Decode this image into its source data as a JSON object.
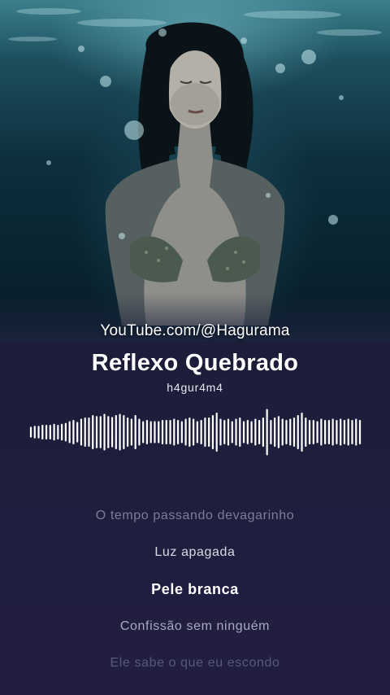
{
  "watermark": "YouTube.com/@Hagurama",
  "track": {
    "title": "Reflexo Quebrado",
    "artist": "h4gur4m4"
  },
  "waveform_levels": [
    0.22,
    0.26,
    0.26,
    0.3,
    0.3,
    0.3,
    0.34,
    0.3,
    0.34,
    0.38,
    0.45,
    0.5,
    0.42,
    0.55,
    0.6,
    0.6,
    0.7,
    0.66,
    0.66,
    0.75,
    0.66,
    0.62,
    0.7,
    0.75,
    0.7,
    0.6,
    0.55,
    0.7,
    0.55,
    0.45,
    0.5,
    0.45,
    0.45,
    0.45,
    0.5,
    0.5,
    0.5,
    0.55,
    0.5,
    0.45,
    0.55,
    0.6,
    0.55,
    0.45,
    0.5,
    0.6,
    0.6,
    0.7,
    0.8,
    0.55,
    0.5,
    0.55,
    0.45,
    0.55,
    0.6,
    0.45,
    0.5,
    0.45,
    0.55,
    0.5,
    0.6,
    0.95,
    0.5,
    0.6,
    0.66,
    0.55,
    0.5,
    0.55,
    0.6,
    0.7,
    0.8,
    0.6,
    0.5,
    0.5,
    0.45,
    0.55,
    0.5,
    0.5,
    0.55,
    0.5,
    0.55,
    0.5,
    0.55,
    0.5,
    0.55,
    0.5
  ],
  "colors": {
    "background_top": "#1d2440",
    "background_bottom": "#221e42",
    "waveform": "#ffffff",
    "active_lyric": "#ffffff"
  },
  "lyrics": [
    "O tempo passando devagarinho",
    "Luz apagada",
    "Pele branca",
    "Confissão sem ninguém",
    "Ele sabe o que eu escondo"
  ],
  "active_lyric_index": 2
}
